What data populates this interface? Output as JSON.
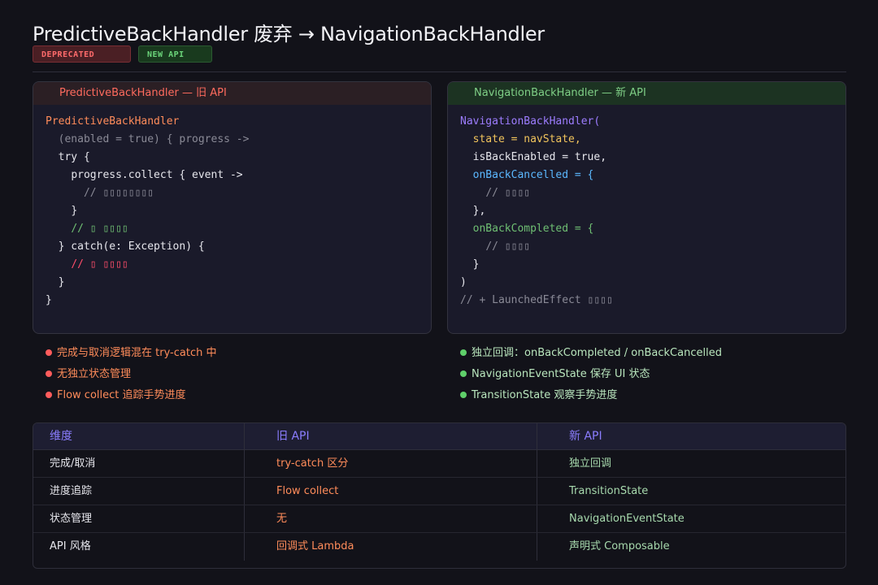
{
  "title": "PredictiveBackHandler 废弃 → NavigationBackHandler",
  "badges": {
    "deprecated": "DEPRECATED",
    "new_api": "NEW API"
  },
  "left_panel": {
    "header": "PredictiveBackHandler — 旧 API",
    "code": [
      {
        "indent": "",
        "text": "PredictiveBackHandler",
        "color": "orange"
      },
      {
        "indent": "  ",
        "text": "(enabled = true) { progress ->",
        "color": "grey"
      },
      {
        "indent": "  ",
        "text": "try {",
        "color": "white"
      },
      {
        "indent": "    ",
        "text": "progress.collect { event ->",
        "color": "white"
      },
      {
        "indent": "      ",
        "text": "// ▯▯▯▯▯▯▯▯",
        "color": "grey"
      },
      {
        "indent": "    ",
        "text": "}",
        "color": "white"
      },
      {
        "indent": "    ",
        "text": "// ▯ ▯▯▯▯",
        "color": "green"
      },
      {
        "indent": "  ",
        "text": "} catch(e: Exception) {",
        "color": "white"
      },
      {
        "indent": "    ",
        "text": "// ▯ ▯▯▯▯",
        "color": "red"
      },
      {
        "indent": "  ",
        "text": "}",
        "color": "white"
      },
      {
        "indent": "",
        "text": "}",
        "color": "white"
      }
    ]
  },
  "right_panel": {
    "header": "NavigationBackHandler — 新 API",
    "code": [
      {
        "indent": "",
        "text": "NavigationBackHandler(",
        "color": "purple"
      },
      {
        "indent": "  ",
        "text": "state = navState,",
        "color": "yellow"
      },
      {
        "indent": "  ",
        "text": "isBackEnabled = true,",
        "color": "white"
      },
      {
        "indent": "  ",
        "text": "onBackCancelled = {",
        "color": "blue"
      },
      {
        "indent": "    ",
        "text": "// ▯▯▯▯",
        "color": "grey"
      },
      {
        "indent": "  ",
        "text": "},",
        "color": "white"
      },
      {
        "indent": "  ",
        "text": "onBackCompleted = {",
        "color": "green"
      },
      {
        "indent": "    ",
        "text": "// ▯▯▯▯",
        "color": "grey"
      },
      {
        "indent": "  ",
        "text": "}",
        "color": "white"
      },
      {
        "indent": "",
        "text": ")",
        "color": "white"
      },
      {
        "indent": "",
        "text": "// + LaunchedEffect ▯▯▯▯",
        "color": "grey"
      }
    ]
  },
  "left_bullets": [
    "完成与取消逻辑混在 try-catch 中",
    "无独立状态管理",
    "Flow collect 追踪手势进度"
  ],
  "right_bullets": [
    "独立回调：onBackCompleted / onBackCancelled",
    "NavigationEventState 保存 UI 状态",
    "TransitionState 观察手势进度"
  ],
  "table": {
    "headers": [
      "维度",
      "旧 API",
      "新 API"
    ],
    "rows": [
      [
        "完成/取消",
        "try-catch 区分",
        "独立回调"
      ],
      [
        "进度追踪",
        "Flow collect",
        "TransitionState"
      ],
      [
        "状态管理",
        "无",
        "NavigationEventState"
      ],
      [
        "API 风格",
        "回调式 Lambda",
        "声明式 Composable"
      ]
    ]
  },
  "colors": {
    "background": "#121219",
    "deprecated": "#ff6b6b",
    "new": "#6bd47a",
    "accent": "#8b7dff"
  }
}
